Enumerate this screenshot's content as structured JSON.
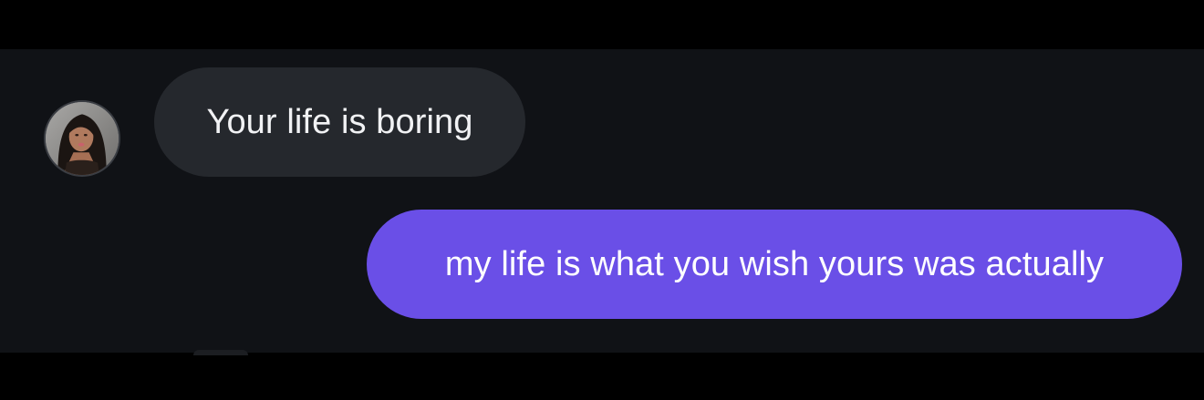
{
  "conversation": {
    "messages": [
      {
        "direction": "received",
        "text": "Your life is boring",
        "has_avatar": true
      },
      {
        "direction": "sent",
        "text": "my life is what you wish yours was actually"
      }
    ]
  },
  "colors": {
    "letterbox": "#000000",
    "chat_background": "#101216",
    "received_bubble": "#25282d",
    "received_text": "#f1f2f4",
    "sent_bubble": "#6a4fe7",
    "sent_text": "#ffffff"
  },
  "icons": {
    "avatar": "contact-profile-photo"
  }
}
